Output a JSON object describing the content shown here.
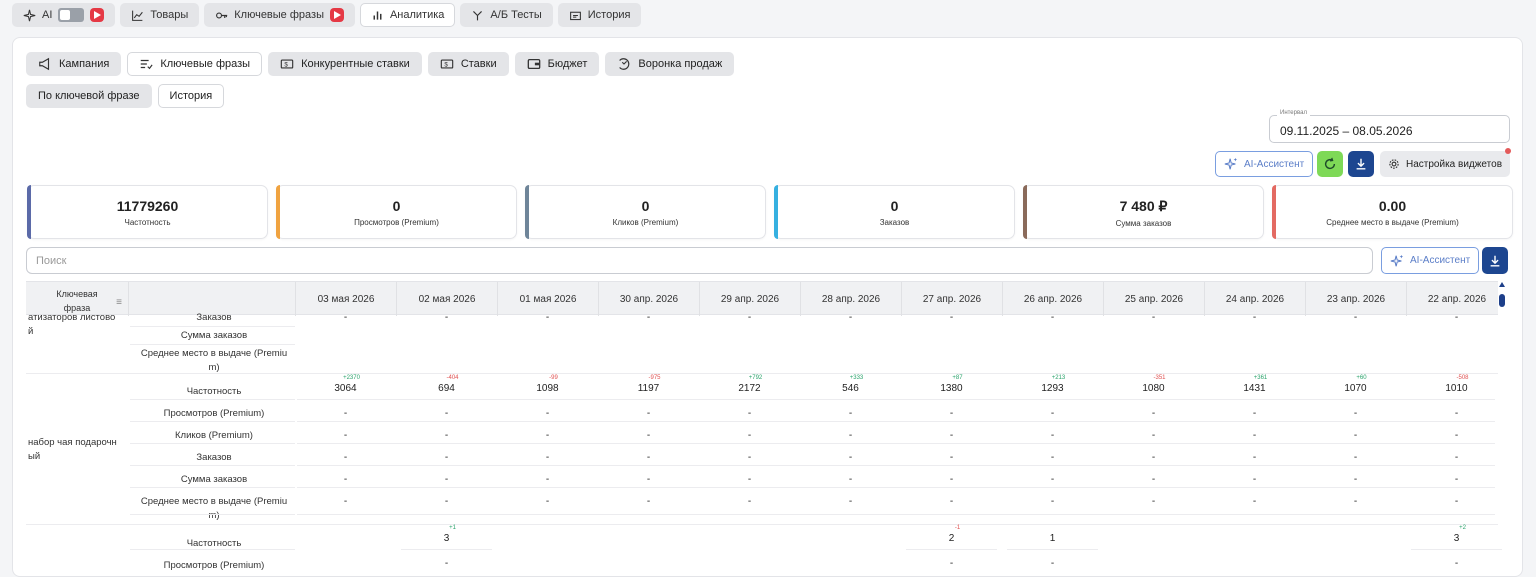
{
  "topnav": {
    "ai_label": "AI",
    "items": [
      {
        "label": "Товары",
        "icon": "chart-line-icon"
      },
      {
        "label": "Ключевые фразы",
        "icon": "key-icon"
      },
      {
        "label": "Аналитика",
        "icon": "bar-chart-icon",
        "active": true
      },
      {
        "label": "А/Б Тесты",
        "icon": "fork-icon"
      },
      {
        "label": "История",
        "icon": "history-icon"
      }
    ]
  },
  "subnav": {
    "items": [
      {
        "label": "Кампания",
        "icon": "megaphone-icon"
      },
      {
        "label": "Ключевые фразы",
        "icon": "list-check-icon",
        "active": true
      },
      {
        "label": "Конкурентные ставки",
        "icon": "money-icon"
      },
      {
        "label": "Ставки",
        "icon": "money-icon"
      },
      {
        "label": "Бюджет",
        "icon": "wallet-icon"
      },
      {
        "label": "Воронка продаж",
        "icon": "funnel-icon"
      }
    ],
    "sub": [
      {
        "label": "По ключевой фразе",
        "active": true
      },
      {
        "label": "История"
      }
    ]
  },
  "interval": {
    "label": "Интервал",
    "value": "09.11.2025 – 08.05.2026"
  },
  "toolbar": {
    "ai_assistant": "AI-Ассистент",
    "settings": "Настройка виджетов"
  },
  "colors": {
    "green": "#7ed957",
    "navy": "#1d4690",
    "accent_blue": "#5b7ec8"
  },
  "kpis": [
    {
      "value": "11779260",
      "label": "Частотность",
      "color": "#5b6aa8"
    },
    {
      "value": "0",
      "label": "Просмотров (Premium)",
      "color": "#f0a340"
    },
    {
      "value": "0",
      "label": "Кликов (Premium)",
      "color": "#6f8599"
    },
    {
      "value": "0",
      "label": "Заказов",
      "color": "#36b0e0"
    },
    {
      "value": "7 480 ₽",
      "label": "Сумма заказов",
      "color": "#8a6a5a"
    },
    {
      "value": "0.00",
      "label": "Среднее место в выдаче (Premium)",
      "color": "#e36a62"
    }
  ],
  "search": {
    "placeholder": "Поиск",
    "ai_assistant": "AI-Ассистент"
  },
  "table": {
    "col_keyword": "Ключевая фраза",
    "dates": [
      "03 мая 2026",
      "02 мая 2026",
      "01 мая 2026",
      "30 апр. 2026",
      "29 апр. 2026",
      "28 апр. 2026",
      "27 апр. 2026",
      "26 апр. 2026",
      "25 апр. 2026",
      "24 апр. 2026",
      "23 апр. 2026",
      "22 апр. 2026"
    ],
    "groups": [
      {
        "keyword": "атизаторов листово\nй",
        "metrics": [
          "Заказов",
          "Сумма заказов",
          "Среднее место в выдаче (Premiu\nm)"
        ],
        "first_row_values": [
          "-",
          "-",
          "-",
          "-",
          "-",
          "-",
          "-",
          "-",
          "-",
          "-",
          "-",
          "-"
        ]
      },
      {
        "keyword": "набор чая подарочн\nый",
        "metrics": [
          "Частотность",
          "Просмотров (Premium)",
          "Кликов (Premium)",
          "Заказов",
          "Сумма заказов",
          "Среднее место в выдаче (Premiu\nm)"
        ],
        "freq": [
          "3064",
          "694",
          "1098",
          "1197",
          "2172",
          "546",
          "1380",
          "1293",
          "1080",
          "1431",
          "1070",
          "1010"
        ],
        "deltas": [
          "+2370",
          "-404",
          "-99",
          "-975",
          "+792",
          "+333",
          "+87",
          "+213",
          "-351",
          "+361",
          "+60",
          "-508"
        ]
      },
      {
        "metrics": [
          "Частотность",
          "Просмотров (Premium)"
        ],
        "freq": [
          "",
          "3",
          "",
          "",
          "",
          "",
          "2",
          "1",
          "",
          "",
          "",
          "3"
        ],
        "deltas": [
          "",
          "+1",
          "",
          "",
          "",
          "",
          "-1",
          "",
          "",
          "",
          "",
          "+2"
        ],
        "second": [
          "",
          "-",
          "",
          "",
          "",
          "",
          "-",
          "-",
          "",
          "",
          "",
          "-"
        ]
      }
    ],
    "dash": "-"
  }
}
